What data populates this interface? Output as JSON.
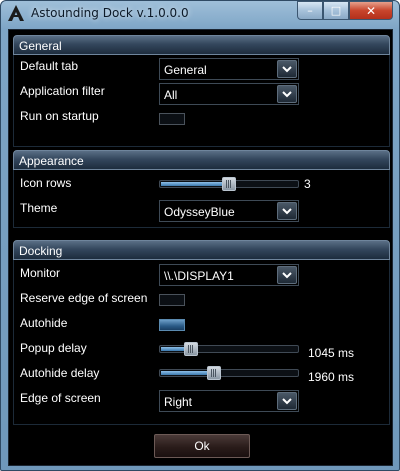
{
  "window": {
    "title": "Astounding Dock v.1.0.0.0",
    "caption": {
      "minimize": "–",
      "maximize": "□",
      "close": "✕"
    }
  },
  "general": {
    "header": "General",
    "default_tab": {
      "label": "Default tab",
      "value": "General"
    },
    "application_filter": {
      "label": "Application filter",
      "value": "All"
    },
    "run_on_startup": {
      "label": "Run on startup",
      "checked": false
    }
  },
  "appearance": {
    "header": "Appearance",
    "icon_rows": {
      "label": "Icon rows",
      "value": "3",
      "fraction": 0.5
    },
    "theme": {
      "label": "Theme",
      "value": "OdysseyBlue"
    }
  },
  "docking": {
    "header": "Docking",
    "monitor": {
      "label": "Monitor",
      "value": "\\\\.\\DISPLAY1"
    },
    "reserve_edge": {
      "label": "Reserve edge of screen",
      "checked": false
    },
    "autohide": {
      "label": "Autohide",
      "checked": true
    },
    "popup_delay": {
      "label": "Popup delay",
      "value": "1045 ms",
      "fraction": 0.2
    },
    "autohide_delay": {
      "label": "Autohide delay",
      "value": "1960 ms",
      "fraction": 0.38
    },
    "edge_of_screen": {
      "label": "Edge of screen",
      "value": "Right"
    }
  },
  "footer": {
    "ok_label": "Ok"
  },
  "colors": {
    "accent": "#3b78ad",
    "group_header": "#34475d",
    "titlebar": "#7ea5c6",
    "close": "#c8452c"
  },
  "icons": {
    "app": "astounding-dock-logo",
    "dropdown": "chevron-down-icon"
  }
}
